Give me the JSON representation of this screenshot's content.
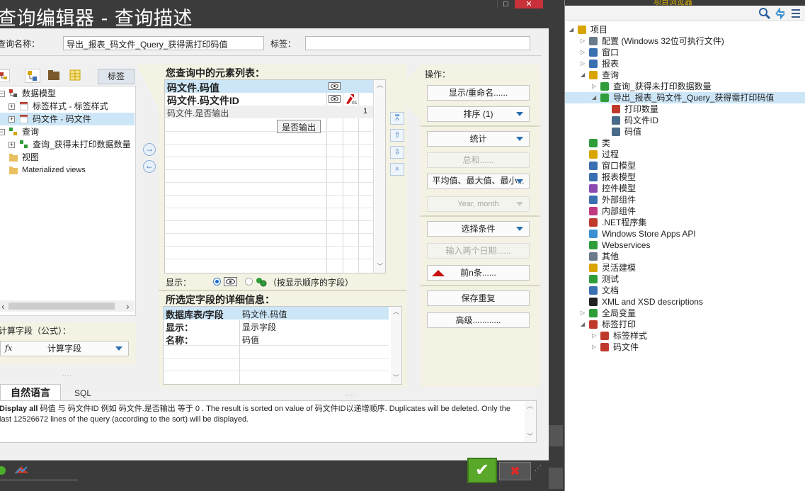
{
  "window": {
    "title": "查询编辑器 - 查询描述",
    "maximize_glyph": "□",
    "close_glyph": "✕"
  },
  "header": {
    "query_name_label": "查询名称：",
    "query_name_value": "导出_报表_码文件_Query_获得需打印码值",
    "tag_label": "标签：",
    "tag_value": ""
  },
  "left_panel": {
    "tab_label": "标签",
    "tree": [
      {
        "label": "数据模型",
        "level": 0
      },
      {
        "label": "标签样式 - 标签样式",
        "level": 1
      },
      {
        "label": "码文件 - 码文件",
        "level": 1,
        "selected": true
      },
      {
        "label": "查询",
        "level": 0
      },
      {
        "label": "查询_获得未打印数据数量",
        "level": 1
      },
      {
        "label": "视图",
        "level": 0
      },
      {
        "label": "Materialized views",
        "level": 0
      }
    ],
    "scroll_left": "‹",
    "scroll_right": "›",
    "calc_label": "计算字段（公式）：",
    "calc_button": "计算字段",
    "calc_icon": "fx"
  },
  "center_panel": {
    "list_title": "您查询中的元素列表：",
    "items": [
      {
        "name": "码文件.码值",
        "bold": true,
        "selected": true,
        "count": ""
      },
      {
        "name": "码文件.码文件ID",
        "bold": true,
        "selected": false,
        "count": ""
      },
      {
        "name": "码文件.是否输出",
        "bold": false,
        "selected": false,
        "count": "1"
      }
    ],
    "tooltip": "是否输出",
    "display_label": "显示：",
    "display_note": "（按显示顺序的字段）",
    "details_title": "所选定字段的详细信息：",
    "details": [
      {
        "key": "数据库表/字段",
        "value": "码文件.码值"
      },
      {
        "key": "显示：",
        "value": "显示字段"
      },
      {
        "key": "名称：",
        "value": "码值"
      }
    ]
  },
  "right_panel": {
    "title": "操作：",
    "buttons": [
      {
        "label": "显示/重命名......",
        "dropdown": false,
        "disabled": false
      },
      {
        "label": "排序 (1)",
        "dropdown": true,
        "disabled": false
      },
      {
        "label": "统计",
        "dropdown": true,
        "disabled": false
      },
      {
        "label": "总和......",
        "dropdown": false,
        "disabled": true
      },
      {
        "label": "平均值、最大值、最小...",
        "dropdown": true,
        "disabled": false
      },
      {
        "label": "Year, month",
        "dropdown": true,
        "disabled": true
      },
      {
        "label": "选择条件",
        "dropdown": true,
        "disabled": false
      },
      {
        "label": "输入两个日期......",
        "dropdown": false,
        "disabled": true
      },
      {
        "label": "前n条......",
        "dropdown": false,
        "disabled": false
      },
      {
        "label": "保存重复",
        "dropdown": false,
        "disabled": false
      },
      {
        "label": "高级............",
        "dropdown": false,
        "disabled": false
      }
    ]
  },
  "bottom_tabs": {
    "natural_language": "自然语言",
    "sql": "SQL",
    "description_bold": "Display all",
    "description_rest": " 码值 与 码文件ID 例如 码文件.是否输出 等于 0 . The result is sorted on value of 码文件ID以递增顺序. Duplicates will be deleted. Only the last 12526672 lines of the query (according to the sort) will be displayed."
  },
  "footer": {
    "ok_glyph": "✔",
    "cancel_glyph": "✖"
  },
  "explorer": {
    "title": "项目浏览器",
    "items": [
      {
        "label": "项目",
        "depth": 0,
        "expand": "open",
        "icon": "project-icon",
        "color": "#d8a400"
      },
      {
        "label": "配置 (Windows 32位可执行文件)",
        "depth": 1,
        "expand": "closed",
        "icon": "gear-icon",
        "color": "#6a7a8a"
      },
      {
        "label": "窗口",
        "depth": 1,
        "expand": "closed",
        "icon": "window-icon",
        "color": "#3a6fb0"
      },
      {
        "label": "报表",
        "depth": 1,
        "expand": "closed",
        "icon": "report-icon",
        "color": "#3a6fb0"
      },
      {
        "label": "查询",
        "depth": 1,
        "expand": "open",
        "icon": "query-icon",
        "color": "#d8a400"
      },
      {
        "label": "查询_获得未打印数据数量",
        "depth": 2,
        "expand": "closed",
        "icon": "query-icon",
        "color": "#2f9e3a"
      },
      {
        "label": "导出_报表_码文件_Query_获得需打印码值",
        "depth": 2,
        "expand": "open",
        "icon": "query-icon",
        "color": "#2f9e3a",
        "selected": true
      },
      {
        "label": "打印数量",
        "depth": 3,
        "expand": "",
        "icon": "field-icon",
        "color": "#c03a2b"
      },
      {
        "label": "码文件ID",
        "depth": 3,
        "expand": "",
        "icon": "field-icon",
        "color": "#4a6a8a"
      },
      {
        "label": "码值",
        "depth": 3,
        "expand": "",
        "icon": "field-icon",
        "color": "#4a6a8a"
      },
      {
        "label": "类",
        "depth": 1,
        "expand": "",
        "icon": "class-icon",
        "color": "#2f9e3a"
      },
      {
        "label": "过程",
        "depth": 1,
        "expand": "",
        "icon": "procedure-icon",
        "color": "#d8a400"
      },
      {
        "label": "窗口模型",
        "depth": 1,
        "expand": "",
        "icon": "window-template-icon",
        "color": "#3a6fb0"
      },
      {
        "label": "报表模型",
        "depth": 1,
        "expand": "",
        "icon": "report-template-icon",
        "color": "#3a6fb0"
      },
      {
        "label": "控件模型",
        "depth": 1,
        "expand": "",
        "icon": "control-template-icon",
        "color": "#8a4ab0"
      },
      {
        "label": "外部组件",
        "depth": 1,
        "expand": "",
        "icon": "component-icon",
        "color": "#3a6fb0"
      },
      {
        "label": "内部组件",
        "depth": 1,
        "expand": "",
        "icon": "component-icon",
        "color": "#c03a80"
      },
      {
        "label": ".NET程序集",
        "depth": 1,
        "expand": "",
        "icon": "dotnet-icon",
        "color": "#c03a2b"
      },
      {
        "label": "Windows Store Apps API",
        "depth": 1,
        "expand": "",
        "icon": "windows-icon",
        "color": "#3a8fd0"
      },
      {
        "label": "Webservices",
        "depth": 1,
        "expand": "",
        "icon": "webservice-icon",
        "color": "#2f9e3a"
      },
      {
        "label": "其他",
        "depth": 1,
        "expand": "",
        "icon": "other-icon",
        "color": "#6a7a8a"
      },
      {
        "label": "灵活建模",
        "depth": 1,
        "expand": "",
        "icon": "model-icon",
        "color": "#d8a400"
      },
      {
        "label": "测试",
        "depth": 1,
        "expand": "",
        "icon": "test-icon",
        "color": "#2f9e3a"
      },
      {
        "label": "文档",
        "depth": 1,
        "expand": "",
        "icon": "document-icon",
        "color": "#3a6fb0"
      },
      {
        "label": "XML and XSD descriptions",
        "depth": 1,
        "expand": "",
        "icon": "xml-icon",
        "color": "#222222"
      },
      {
        "label": "全局变量",
        "depth": 1,
        "expand": "closed",
        "icon": "variable-icon",
        "color": "#2f9e3a"
      },
      {
        "label": "标签打印",
        "depth": 1,
        "expand": "open",
        "icon": "label-print-icon",
        "color": "#c03a2b"
      },
      {
        "label": "标签样式",
        "depth": 2,
        "expand": "closed",
        "icon": "table-icon",
        "color": "#c03a2b"
      },
      {
        "label": "码文件",
        "depth": 2,
        "expand": "closed",
        "icon": "table-icon",
        "color": "#c03a2b"
      }
    ]
  },
  "colors": {
    "accent": "#2a6fb0",
    "selection": "#cde6f7",
    "panel_beige": "#f3f2e3",
    "ok_green": "#5aa82a",
    "cancel_red": "#c8303a"
  }
}
